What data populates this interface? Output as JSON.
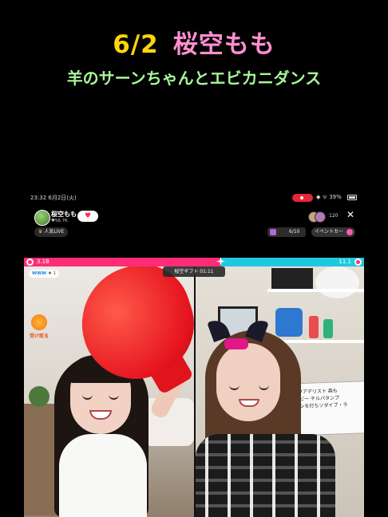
{
  "caption": {
    "date": "6/2",
    "name": "桜空もも",
    "subtitle": "羊のサーンちゃんとエビカニダンス"
  },
  "status_bar": {
    "time": "23:32 6月2日(火)",
    "system": "◆ ᯤ 39%"
  },
  "host": {
    "name": "桜空もも",
    "likes": "♥56.7K",
    "follow_icon": "heart-add-icon",
    "viewer_count": "120",
    "close_icon": "close-icon"
  },
  "tags": {
    "ranking_icon": "♛",
    "ranking_label": "人気LIVE",
    "gift_label": "6/10",
    "event_label": "イベントカー"
  },
  "battle": {
    "left_score": "3.1B",
    "right_score": "11.1",
    "timer": "桜空ギフト 01:11",
    "colors": {
      "left": "#ff2d78",
      "right": "#1fc8e0"
    }
  },
  "left_panel": {
    "rank_badge": "WWW",
    "rank_num": "1",
    "receive_label": "受け取る"
  },
  "right_panel": {
    "board_text": "2 ガワアデリスト 森も\n2. ゲビー チルパタンプ\n2. ランを打ちソダイブ・ラ\n〜"
  }
}
